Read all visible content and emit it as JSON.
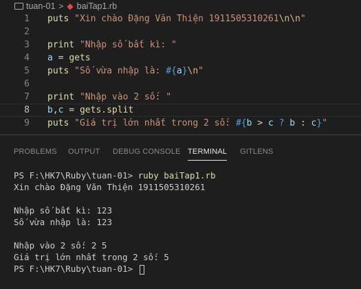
{
  "breadcrumb": {
    "folder": "tuan-01",
    "separator": ">",
    "file": "baiTap1.rb"
  },
  "editor": {
    "lines": [
      {
        "num": "1",
        "segments": [
          [
            "fn",
            "puts"
          ],
          [
            "op",
            " "
          ],
          [
            "str",
            "\"Xin chào Đặng Văn Thiện 1911505310261"
          ],
          [
            "esc",
            "\\n\\n"
          ],
          [
            "str",
            "\""
          ]
        ]
      },
      {
        "num": "2",
        "segments": []
      },
      {
        "num": "3",
        "segments": [
          [
            "fn",
            "print"
          ],
          [
            "op",
            " "
          ],
          [
            "str",
            "\"Nhập số bất kì: \""
          ]
        ]
      },
      {
        "num": "4",
        "segments": [
          [
            "var",
            "a"
          ],
          [
            "op",
            " = "
          ],
          [
            "fn",
            "gets"
          ]
        ]
      },
      {
        "num": "5",
        "segments": [
          [
            "fn",
            "puts"
          ],
          [
            "op",
            " "
          ],
          [
            "str",
            "\"Số vừa nhập là: "
          ],
          [
            "kw",
            "#{"
          ],
          [
            "var",
            "a"
          ],
          [
            "kw",
            "}"
          ],
          [
            "esc",
            "\\n"
          ],
          [
            "str",
            "\""
          ]
        ]
      },
      {
        "num": "6",
        "segments": []
      },
      {
        "num": "7",
        "segments": [
          [
            "fn",
            "print"
          ],
          [
            "op",
            " "
          ],
          [
            "str",
            "\"Nhập vào 2 số: \""
          ]
        ]
      },
      {
        "num": "8",
        "segments": [
          [
            "var",
            "b"
          ],
          [
            "op",
            ","
          ],
          [
            "var",
            "c"
          ],
          [
            "op",
            " = "
          ],
          [
            "fn",
            "gets"
          ],
          [
            "op",
            "."
          ],
          [
            "fn",
            "split"
          ]
        ],
        "current": true
      },
      {
        "num": "9",
        "segments": [
          [
            "fn",
            "puts"
          ],
          [
            "op",
            " "
          ],
          [
            "str",
            "\"Giá trị lớn nhất trong 2 số: "
          ],
          [
            "kw",
            "#{"
          ],
          [
            "var",
            "b"
          ],
          [
            "op",
            " > "
          ],
          [
            "var",
            "c"
          ],
          [
            "op",
            " "
          ],
          [
            "kw",
            "?"
          ],
          [
            "op",
            " "
          ],
          [
            "var",
            "b"
          ],
          [
            "op",
            " : "
          ],
          [
            "var",
            "c"
          ],
          [
            "kw",
            "}"
          ],
          [
            "str",
            "\""
          ]
        ]
      }
    ]
  },
  "panel": {
    "tabs": [
      "PROBLEMS",
      "OUTPUT",
      "DEBUG CONSOLE",
      "TERMINAL",
      "GITLENS"
    ],
    "active_tab": "TERMINAL"
  },
  "terminal": {
    "prompt1": "PS F:\\HK7\\Ruby\\tuan-01> ",
    "command": "ruby baiTap1.rb",
    "out1": "Xin chào Đặng Văn Thiện 1911505310261",
    "out2": "Nhập số bất kì: 123",
    "out3": "Số vừa nhập là: 123",
    "out4": "Nhập vào 2 số: 2 5",
    "out5": "Giá trị lớn nhất trong 2 số: 5",
    "prompt2": "PS F:\\HK7\\Ruby\\tuan-01> "
  }
}
